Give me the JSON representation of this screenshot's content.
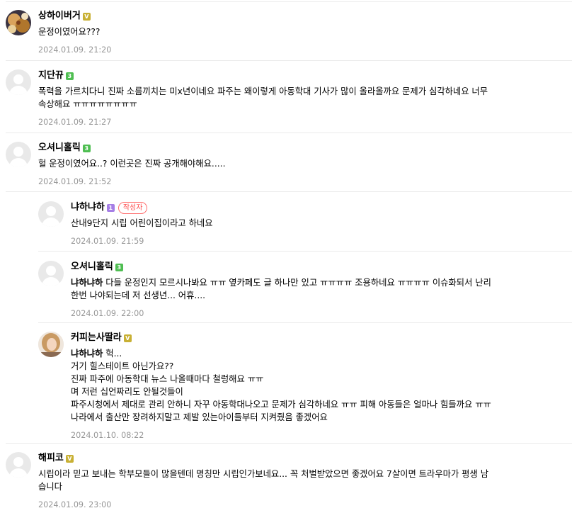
{
  "colors": {
    "level_gold": "#c8b034",
    "level_green": "#4fbe52",
    "level_purple": "#a57ee5",
    "author_badge": "#ff4e4e",
    "date": "#979797",
    "separator": "#ebebeb"
  },
  "comments": [
    {
      "nickname": "상하이버거",
      "level": "V",
      "level_color": "#c8b034",
      "avatar": "photo-food",
      "lines": [
        "운정이였어요???"
      ],
      "date": "2024.01.09. 21:20"
    },
    {
      "nickname": "지단뀨",
      "level": "3",
      "level_color": "#4fbe52",
      "avatar": "default",
      "lines": [
        "폭력을 가르치다니 진짜 소름끼치는 미x년이네요 파주는 왜이렇게 아동학대 기사가 많이 올라올까요 문제가 심각하네요 너무",
        "속상해요 ㅠㅠㅠㅠㅠㅠㅠㅠ"
      ],
      "date": "2024.01.09. 21:27"
    },
    {
      "nickname": "오셔니홀릭",
      "level": "3",
      "level_color": "#4fbe52",
      "avatar": "default",
      "lines": [
        "헐 운정이였어요..? 이런곳은 진짜 공개해야해요....."
      ],
      "date": "2024.01.09. 21:52"
    }
  ],
  "replies": [
    {
      "nickname": "냐하냐하",
      "level": "1",
      "level_color": "#a57ee5",
      "author_badge": "작성자",
      "avatar": "default",
      "lines": [
        "산내9단지 시립 어린이집이라고 하네요"
      ],
      "date": "2024.01.09. 21:59"
    },
    {
      "nickname": "오셔니홀릭",
      "level": "3",
      "level_color": "#4fbe52",
      "avatar": "default",
      "mention": "냐하냐하",
      "first_line": "다들 운정인지 모르시나봐요 ㅠㅠ 옆카페도 글 하나만 있고 ㅠㅠㅠㅠ 조용하네요 ㅠㅠㅠㅠ 이슈화되서 난리",
      "lines": [
        "한번 나야되는데 저 선생년... 어휴...."
      ],
      "date": "2024.01.09. 22:00"
    },
    {
      "nickname": "커피는사딸라",
      "level": "V",
      "level_color": "#c8b034",
      "avatar": "photo-person",
      "mention": "냐하냐하",
      "first_line": "헉...",
      "lines": [
        "거기 힐스테이트 아닌가요??",
        "진짜 파주에 아동학대 뉴스 나올때마다 철렁해요 ㅠㅠ",
        "며 저런 십언짜리도 안될것들이",
        "파주시청에서 제대로 관리 안하니 자꾸 아동학대나오고 문제가 심각하네요 ㅠㅠ 피해 아동들은 얼마나 힘들까요 ㅠㅠ",
        "나라에서 출산만 장려하지말고 제발 있는아이들부터 지켜줬음 좋겠어요"
      ],
      "date": "2024.01.10. 08:22"
    }
  ],
  "last_comment": {
    "nickname": "해피코",
    "level": "V",
    "level_color": "#c8b034",
    "avatar": "default",
    "lines": [
      "시립이라 믿고 보내는 학부모들이 많을텐데 명칭만 시립인가보네요... 꼭 처벌받았으면 좋겠어요 7살이면 트라우마가 평생 남",
      "습니다"
    ],
    "date": "2024.01.09. 23:00"
  }
}
